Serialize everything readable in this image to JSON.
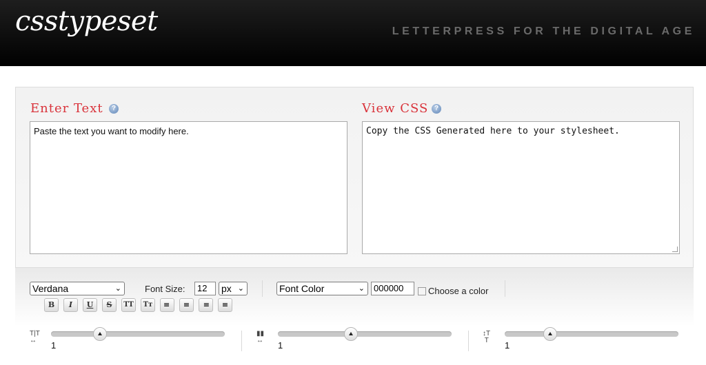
{
  "header": {
    "logo": "csstypeset",
    "tagline": "LETTERPRESS FOR THE DIGITAL AGE"
  },
  "editor": {
    "enter_title": "Enter Text",
    "enter_placeholder": "Paste the text you want to modify here.",
    "view_title": "View CSS",
    "view_text": "Copy the CSS Generated here to your stylesheet.",
    "help_glyph": "?"
  },
  "toolbar": {
    "font_family": "Verdana",
    "font_size_label": "Font Size:",
    "font_size_value": "12",
    "font_size_unit": "px",
    "font_color_select": "Font Color",
    "font_color_value": "000000",
    "choose_color_alt": "Choose a color",
    "format_buttons": [
      {
        "name": "bold-button",
        "label": "B"
      },
      {
        "name": "italic-button",
        "label": "I"
      },
      {
        "name": "underline-button",
        "label": "U"
      },
      {
        "name": "strikethrough-button",
        "label": "S"
      },
      {
        "name": "uppercase-button",
        "label": "TT"
      },
      {
        "name": "small-caps-button",
        "label": "Tт"
      },
      {
        "name": "align-left-button",
        "label": "≡"
      },
      {
        "name": "align-center-button",
        "label": "≡"
      },
      {
        "name": "align-right-button",
        "label": "≡"
      },
      {
        "name": "justify-button",
        "label": "≡"
      }
    ]
  },
  "sliders": [
    {
      "name": "letter-spacing",
      "icon": "letter-spacing-icon",
      "value": "1",
      "level": 0.28
    },
    {
      "name": "word-spacing",
      "icon": "word-spacing-icon",
      "value": "1",
      "level": 0.42
    },
    {
      "name": "line-height",
      "icon": "line-height-icon",
      "value": "1",
      "level": 0.26
    }
  ]
}
